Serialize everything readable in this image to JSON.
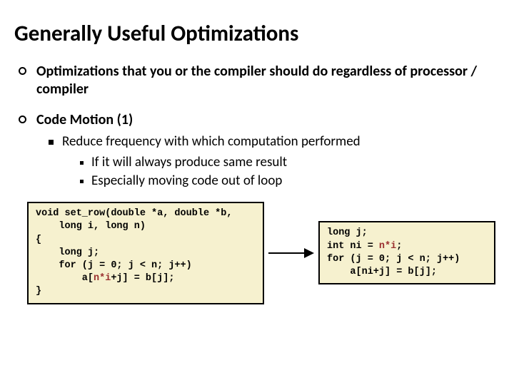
{
  "title": "Generally Useful Optimizations",
  "bullets": [
    {
      "text": "Optimizations that you or the compiler should do regardless of processor / compiler"
    },
    {
      "text": "Code Motion (1)"
    }
  ],
  "sub1": "Reduce frequency with which computation performed",
  "sub2": [
    "If it will always produce same result",
    "Especially moving code out of loop"
  ],
  "code_left": {
    "l1": "void set_row(double *a, double *b,",
    "l2": "    long i, long n)",
    "l3": "{",
    "l4": "    long j;",
    "l5": "    for (j = 0; j < n; j++)",
    "l6a": "        a[",
    "l6_hl": "n*i",
    "l6b": "+j] = b[j];",
    "l7": "}"
  },
  "code_right": {
    "l1": "long j;",
    "l2a": "int ni = ",
    "l2_hl": "n*i",
    "l2b": ";",
    "l3": "for (j = 0; j < n; j++)",
    "l4": "    a[ni+j] = b[j];"
  }
}
